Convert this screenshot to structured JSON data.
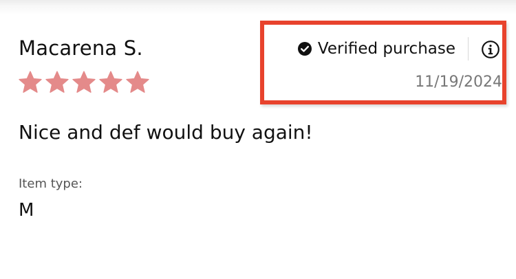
{
  "review": {
    "reviewer_name": "Macarena S.",
    "rating": {
      "value": 5,
      "max": 5
    },
    "body": "Nice and def would buy again!",
    "verified_label": "Verified purchase",
    "date": "11/19/2024",
    "attribute": {
      "label": "Item type:",
      "value": "M"
    }
  },
  "icons": {
    "star": "star-icon",
    "verified": "check-circle-icon",
    "info": "info-icon"
  },
  "colors": {
    "star": "#e48a8a",
    "highlight_border": "#e8432d",
    "text_primary": "#111111",
    "text_muted": "#777777"
  }
}
